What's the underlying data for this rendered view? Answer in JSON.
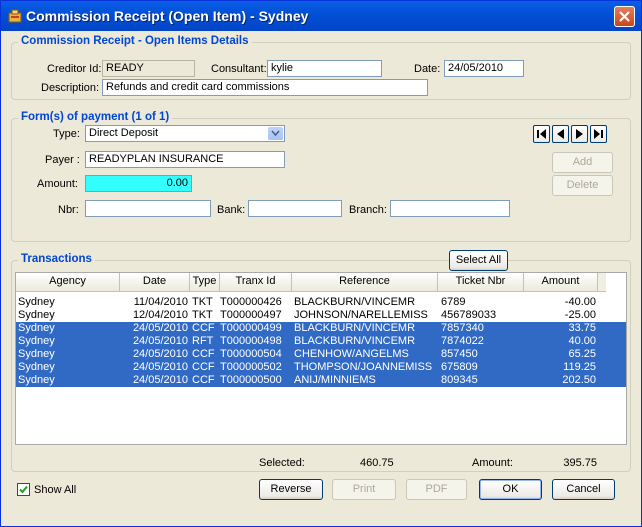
{
  "window": {
    "title": "Commission Receipt (Open Item) - Sydney"
  },
  "details": {
    "group_title": "Commission Receipt - Open Items Details",
    "creditor_label": "Creditor Id:",
    "creditor_value": "READY",
    "consultant_label": "Consultant:",
    "consultant_value": "kylie",
    "date_label": "Date:",
    "date_value": "24/05/2010",
    "description_label": "Description:",
    "description_value": "Refunds and credit card commissions"
  },
  "payment": {
    "group_title": "Form(s) of payment (1 of 1)",
    "type_label": "Type:",
    "type_value": "Direct Deposit",
    "payer_label": "Payer :",
    "payer_value": "READYPLAN INSURANCE",
    "amount_label": "Amount:",
    "amount_value": "0.00",
    "nbr_label": "Nbr:",
    "nbr_value": "",
    "bank_label": "Bank:",
    "bank_value": "",
    "branch_label": "Branch:",
    "branch_value": "",
    "add_label": "Add",
    "delete_label": "Delete"
  },
  "transactions": {
    "group_title": "Transactions",
    "select_all_label": "Select All",
    "columns": [
      "Agency",
      "Date",
      "Type",
      "Tranx Id",
      "Reference",
      "Ticket Nbr",
      "Amount"
    ],
    "rows": [
      {
        "agency": "Sydney",
        "date": "11/04/2010",
        "type": "TKT",
        "tranx_id": "T000000426",
        "reference": "BLACKBURN/VINCEMR",
        "ticket": "6789",
        "amount": "-40.00",
        "selected": false
      },
      {
        "agency": "Sydney",
        "date": "12/04/2010",
        "type": "TKT",
        "tranx_id": "T000000497",
        "reference": "JOHNSON/NARELLEMISS",
        "ticket": "456789033",
        "amount": "-25.00",
        "selected": false
      },
      {
        "agency": "Sydney",
        "date": "24/05/2010",
        "type": "CCF",
        "tranx_id": "T000000499",
        "reference": "BLACKBURN/VINCEMR",
        "ticket": "7857340",
        "amount": "33.75",
        "selected": true
      },
      {
        "agency": "Sydney",
        "date": "24/05/2010",
        "type": "RFT",
        "tranx_id": "T000000498",
        "reference": "BLACKBURN/VINCEMR",
        "ticket": "7874022",
        "amount": "40.00",
        "selected": true
      },
      {
        "agency": "Sydney",
        "date": "24/05/2010",
        "type": "CCF",
        "tranx_id": "T000000504",
        "reference": "CHENHOW/ANGELMS",
        "ticket": "857450",
        "amount": "65.25",
        "selected": true
      },
      {
        "agency": "Sydney",
        "date": "24/05/2010",
        "type": "CCF",
        "tranx_id": "T000000502",
        "reference": "THOMPSON/JOANNEMISS",
        "ticket": "675809",
        "amount": "119.25",
        "selected": true
      },
      {
        "agency": "Sydney",
        "date": "24/05/2010",
        "type": "CCF",
        "tranx_id": "T000000500",
        "reference": "ANIJ/MINNIEMS",
        "ticket": "809345",
        "amount": "202.50",
        "selected": true
      }
    ],
    "selected_label": "Selected:",
    "selected_value": "460.75",
    "amount_label": "Amount:",
    "amount_value": "395.75"
  },
  "footer": {
    "show_all_label": "Show All",
    "show_all_checked": true,
    "reverse_label": "Reverse",
    "print_label": "Print",
    "pdf_label": "PDF",
    "ok_label": "OK",
    "cancel_label": "Cancel"
  },
  "colors": {
    "titlebar": "#0350d8",
    "group_title": "#0046d5",
    "selection": "#316ac5",
    "amount_field": "#33ffff"
  }
}
